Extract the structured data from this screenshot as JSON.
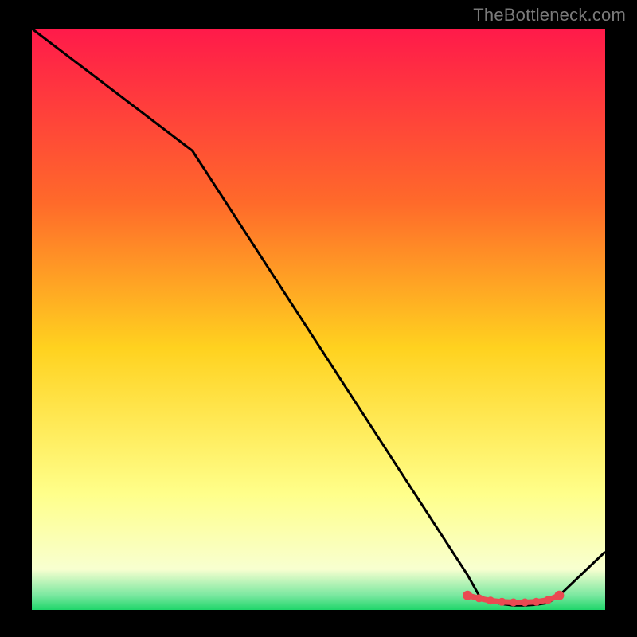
{
  "attribution": "TheBottleneck.com",
  "colors": {
    "bg_black": "#000000",
    "grad_top": "#ff1a4a",
    "grad_mid1": "#ff6a2a",
    "grad_mid2": "#ffd21f",
    "grad_low": "#ffff8a",
    "grad_green": "#1fd66a",
    "curve": "#000000",
    "nodule": "#ea4a52",
    "attribution": "#7a7a7a"
  },
  "chart_data": {
    "type": "line",
    "xlabel": "",
    "ylabel": "",
    "xlim": [
      0,
      100
    ],
    "ylim": [
      0,
      100
    ],
    "grid": false,
    "legend": false,
    "series": [
      {
        "name": "bottleneck-curve",
        "x": [
          0,
          28,
          76,
          78,
          80,
          82,
          84,
          86,
          88,
          90,
          92,
          100
        ],
        "values": [
          100,
          79,
          6,
          2.5,
          1.5,
          1.0,
          0.8,
          0.8,
          0.9,
          1.2,
          2.5,
          10
        ]
      }
    ],
    "markers": {
      "name": "optimal-region",
      "x": [
        76,
        78,
        80,
        82,
        84,
        86,
        88,
        90,
        92
      ],
      "values": [
        2.5,
        2.0,
        1.6,
        1.4,
        1.3,
        1.3,
        1.4,
        1.7,
        2.5
      ]
    },
    "gradient_stops": [
      {
        "offset": 0.0,
        "color": "#ff1a4a"
      },
      {
        "offset": 0.3,
        "color": "#ff6a2a"
      },
      {
        "offset": 0.55,
        "color": "#ffd21f"
      },
      {
        "offset": 0.8,
        "color": "#ffff8a"
      },
      {
        "offset": 0.93,
        "color": "#f8ffd0"
      },
      {
        "offset": 0.975,
        "color": "#7ae8a0"
      },
      {
        "offset": 1.0,
        "color": "#1fd66a"
      }
    ]
  }
}
